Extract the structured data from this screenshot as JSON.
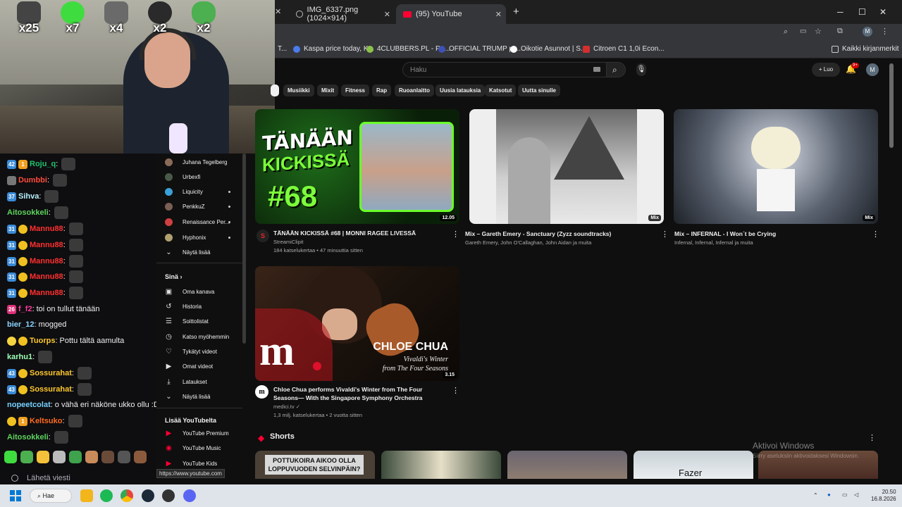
{
  "overlay": {
    "emote_counts": [
      "x25",
      "x7",
      "x4",
      "x2",
      "x2"
    ]
  },
  "chat": {
    "messages": [
      {
        "badges": [
          "42",
          "1"
        ],
        "user": "Roju_q",
        "color": "#1cc36b",
        "text": ""
      },
      {
        "badges": [
          "img"
        ],
        "user": "Dumbbi",
        "color": "#ff4b3e",
        "text": ""
      },
      {
        "badges": [
          "37"
        ],
        "user": "Sihva",
        "color": "#b6f0ff",
        "text": ""
      },
      {
        "badges": [],
        "user": "Aitosokkeli",
        "color": "#5ed35e",
        "text": ""
      },
      {
        "badges": [
          "31",
          "crown"
        ],
        "user": "Mannu88",
        "color": "#ff3030",
        "text": ""
      },
      {
        "badges": [
          "31",
          "crown"
        ],
        "user": "Mannu88",
        "color": "#ff3030",
        "text": ""
      },
      {
        "badges": [
          "31",
          "crown"
        ],
        "user": "Mannu88",
        "color": "#ff3030",
        "text": ""
      },
      {
        "badges": [
          "31",
          "crown"
        ],
        "user": "Mannu88",
        "color": "#ff3030",
        "text": ""
      },
      {
        "badges": [
          "31",
          "crown"
        ],
        "user": "Mannu88",
        "color": "#ff3030",
        "text": ""
      },
      {
        "badges": [
          "26"
        ],
        "user": "f_f2",
        "color": "#ff3a9d",
        "text": "toi on tullut tänään"
      },
      {
        "badges": [],
        "user": "bier_12",
        "color": "#8ad5ff",
        "text": "mogged"
      },
      {
        "badges": [
          "pika",
          "crown"
        ],
        "user": "Tuorps",
        "color": "#ffc72e",
        "text": "Pottu tältä aamulta"
      },
      {
        "badges": [],
        "user": "karhu1",
        "color": "#9dffb3",
        "text": ""
      },
      {
        "badges": [
          "43",
          "crown"
        ],
        "user": "Sossurahat",
        "color": "#ffc72e",
        "text": ""
      },
      {
        "badges": [
          "43",
          "crown"
        ],
        "user": "Sossurahat",
        "color": "#ffc72e",
        "text": ""
      },
      {
        "badges": [],
        "user": "nopeetcolat",
        "color": "#76d1ff",
        "text": "o vähä eri näköne ukko ollu :D"
      },
      {
        "badges": [
          "crown",
          "1"
        ],
        "user": "Keltsuko",
        "color": "#ff6a1f",
        "text": ""
      },
      {
        "badges": [],
        "user": "Aitosokkeli",
        "color": "#5ed35e",
        "text": ""
      }
    ],
    "input_placeholder": "Lähetä viesti"
  },
  "browser": {
    "tabs": [
      {
        "label": "IMG_6337.png (1024×914)"
      },
      {
        "label": "(95) YouTube"
      }
    ],
    "bookmarks": [
      {
        "label": "Kaspa price today, K...",
        "color": "#4b7bec"
      },
      {
        "label": "4CLUBBERS.PL - Po...",
        "color": "#8bc34a"
      },
      {
        "label": "OFFICIAL TRUMP pr...",
        "color": "#3f51b5"
      },
      {
        "label": "Oikotie Asunnot | S...",
        "color": "#ffffff"
      },
      {
        "label": "Citroen C1 1,0i Econ...",
        "color": "#d32f2f"
      }
    ],
    "bookmarks_truncated": "T...",
    "all_bookmarks": "Kaikki kirjanmerkit",
    "status_url": "https://www.youtube.com"
  },
  "youtube": {
    "search_placeholder": "Haku",
    "create_label": "Luo",
    "notif_badge": "9+",
    "avatar_letter": "M",
    "chips": [
      "Musiikki",
      "Mixit",
      "Fitness",
      "Rap",
      "Ruoanlaitto",
      "Uusia latauksia",
      "Katsotut",
      "Uutta sinulle"
    ],
    "sidebar": {
      "subscriptions": [
        {
          "label": "Juhana Tegelberg",
          "dot": false,
          "color": "#8a6b5a"
        },
        {
          "label": "Urbexfi",
          "dot": false,
          "color": "#4a5a4a"
        },
        {
          "label": "Liquicity",
          "dot": true,
          "color": "#3aa0d8"
        },
        {
          "label": "PenkkuZ",
          "dot": true,
          "color": "#7a5f55"
        },
        {
          "label": "Renaissance Per...",
          "dot": true,
          "color": "#d04040"
        },
        {
          "label": "Hyphonix",
          "dot": true,
          "color": "#b0a070"
        }
      ],
      "show_more": "Näytä lisää",
      "you_header": "Sinä",
      "you_items": [
        {
          "label": "Oma kanava",
          "icon": "channel-icon",
          "glyph": "▣"
        },
        {
          "label": "Historia",
          "icon": "history-icon",
          "glyph": "↺"
        },
        {
          "label": "Soittolistat",
          "icon": "playlists-icon",
          "glyph": "☰"
        },
        {
          "label": "Katso myöhemmin",
          "icon": "clock-icon",
          "glyph": "◷"
        },
        {
          "label": "Tykätyt videot",
          "icon": "thumbs-up-icon",
          "glyph": "👍"
        },
        {
          "label": "Omat videot",
          "icon": "video-icon",
          "glyph": "▶"
        },
        {
          "label": "Lataukset",
          "icon": "download-icon",
          "glyph": "⤓"
        }
      ],
      "show_more_2": "Näytä lisää",
      "more_header": "Lisää YouTubelta",
      "more_items": [
        {
          "label": "YouTube Premium"
        },
        {
          "label": "YouTube Music"
        },
        {
          "label": "YouTube Kids"
        }
      ]
    },
    "videos": [
      {
        "title": "TÄNÄÄN KICKISSÄ #68 | MONNI RAGEE LIVESSÄ",
        "channel": "StreamiClipit",
        "stats": "184 katselukertaa • 47 minuuttia sitten",
        "duration": "12.05",
        "thumb_text_1": "TÄNÄÄN",
        "thumb_text_2": "KICKISSÄ",
        "thumb_text_3": "#68"
      },
      {
        "title": "Mix – Gareth Emery - Sanctuary (Zyzz soundtracks)",
        "channel": "Gareth Emery, John O'Callaghan, John Aidan ja muita",
        "stats": "",
        "duration": "Mix"
      },
      {
        "title": "Mix – INFERNAL - I Won´t be Crying",
        "channel": "Infernal, Infernal, Infernal ja muita",
        "stats": "",
        "duration": "Mix"
      },
      {
        "title": "Chloe Chua performs Vivaldi's Winter from The Four Seasons— With the Singapore Symphony Orchestra",
        "channel": "medici.tv",
        "stats": "1,3 milj. katselukertaa • 2 vuotta sitten",
        "duration": "3.15",
        "thumb_name": "CHLOE CHUA",
        "thumb_sub_1": "Vivaldi's Winter",
        "thumb_sub_2": "from The Four Seasons",
        "thumb_logo": "m"
      }
    ],
    "shorts_header": "Shorts",
    "shorts": [
      {
        "caption": "POTTUKOIRA AIKOO OLLA LOPPUVUODEN SELVINPÄIN?"
      },
      {
        "caption": ""
      },
      {
        "caption": ""
      },
      {
        "caption": "Fazer"
      },
      {
        "caption": ""
      }
    ]
  },
  "windows": {
    "watermark_1": "Aktivoi Windows",
    "watermark_2": "Siirry asetuksiin aktivoidaksesi Windowsin.",
    "search_label": "Hae",
    "time": "20.50",
    "date": "16.8.2026"
  }
}
